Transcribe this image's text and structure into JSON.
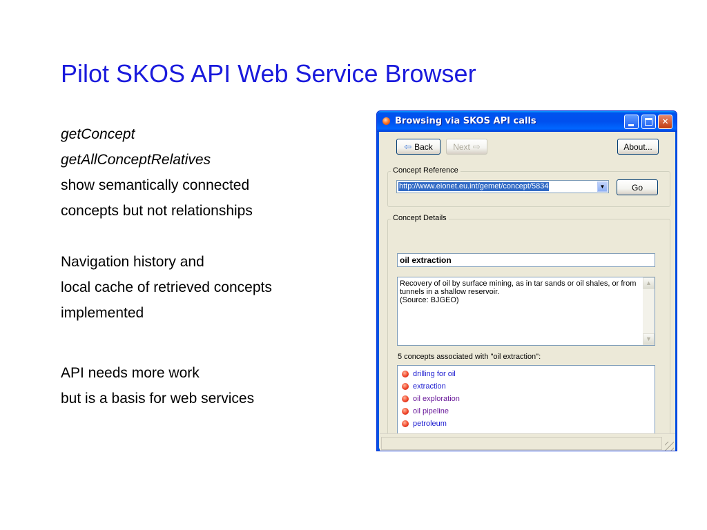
{
  "slide": {
    "title": "Pilot SKOS API Web Service Browser",
    "lines": {
      "l1": "getConcept",
      "l2": "getAllConceptRelatives",
      "l3": "show semantically connected",
      "l4": "concepts but not relationships",
      "l5": "Navigation history and",
      "l6": "local cache of retrieved concepts",
      "l7": "implemented",
      "l8": "API needs more work",
      "l9": "but is a basis for web services"
    }
  },
  "window": {
    "title": "Browsing via SKOS API calls",
    "toolbar": {
      "back_label": "Back",
      "next_label": "Next",
      "about_label": "About..."
    },
    "concept_reference": {
      "legend": "Concept Reference",
      "url_value": "http://www.eionet.eu.int/gemet/concept/5834",
      "go_label": "Go"
    },
    "concept_details": {
      "legend": "Concept Details",
      "name": "oil extraction",
      "description_lines": [
        "Recovery of oil by surface mining, as in tar sands or oil shales, or from",
        "tunnels in a shallow reservoir.",
        "(Source: BJGEO)"
      ],
      "associated_label": "5 concepts associated with \"oil extraction\":",
      "associated": [
        {
          "label": "drilling for oil"
        },
        {
          "label": "extraction"
        },
        {
          "label": "oil exploration"
        },
        {
          "label": "oil pipeline"
        },
        {
          "label": "petroleum"
        }
      ]
    },
    "icons": {
      "title_icon": "app-icon",
      "back_icon": "back-arrow-icon",
      "next_icon": "next-arrow-icon",
      "item_icon": "concept-bullet-icon"
    },
    "colors": {
      "title_bar": "#0053ee",
      "link": "#1a1ad0",
      "visited_link": "#6a1a9a",
      "selection": "#316ac5"
    }
  }
}
